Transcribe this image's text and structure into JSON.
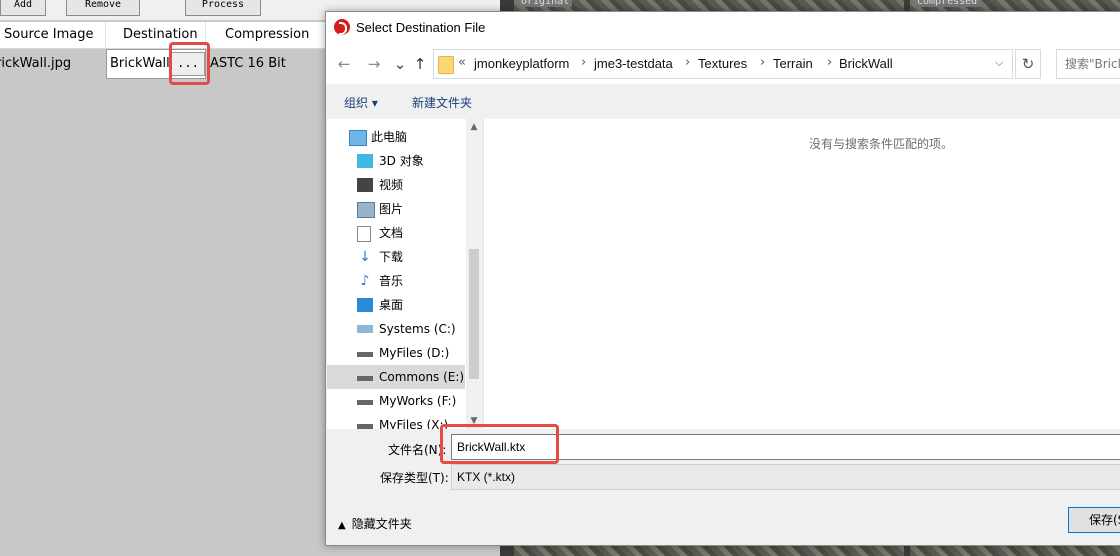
{
  "background_app": {
    "buttons": [
      "Add",
      "Remove",
      "Process"
    ],
    "columns": [
      "Source Image",
      "Destination",
      "Compression"
    ],
    "row": {
      "source": "rickWall.jpg",
      "destination": "BrickWall.d",
      "dots": "...",
      "compression": "ASTC 16 Bit"
    },
    "image_labels": [
      "original",
      "compressed"
    ]
  },
  "dialog": {
    "title": "Select Destination File",
    "breadcrumb_overflow": "«",
    "breadcrumbs": [
      "jmonkeyplatform",
      "jme3-testdata",
      "Textures",
      "Terrain",
      "BrickWall"
    ],
    "search_placeholder": "搜索\"Brick",
    "commands": {
      "organize": "组织 ▾",
      "new_folder": "新建文件夹"
    },
    "sidebar": [
      {
        "label": "此电脑",
        "icon": "computer-icon"
      },
      {
        "label": "3D 对象",
        "icon": "3d-objects-icon"
      },
      {
        "label": "视频",
        "icon": "video-icon"
      },
      {
        "label": "图片",
        "icon": "pictures-icon"
      },
      {
        "label": "文档",
        "icon": "documents-icon"
      },
      {
        "label": "下载",
        "icon": "downloads-icon"
      },
      {
        "label": "音乐",
        "icon": "music-icon"
      },
      {
        "label": "桌面",
        "icon": "desktop-icon"
      },
      {
        "label": "Systems (C:)",
        "icon": "drive-icon"
      },
      {
        "label": "MyFiles (D:)",
        "icon": "drive-icon"
      },
      {
        "label": "Commons (E:)",
        "icon": "drive-icon"
      },
      {
        "label": "MyWorks (F:)",
        "icon": "drive-icon"
      },
      {
        "label": "MyFiles (X:)",
        "icon": "drive-icon"
      }
    ],
    "empty_message": "没有与搜索条件匹配的项。",
    "filename_label": "文件名(N):",
    "filename_value": "BrickWall.ktx",
    "filetype_label": "保存类型(T):",
    "filetype_value": "KTX (*.ktx)",
    "hide_folders": "隐藏文件夹",
    "save_button": "保存(S)"
  },
  "colors": {
    "highlight": "#e44b44",
    "accent": "#0078d7"
  }
}
